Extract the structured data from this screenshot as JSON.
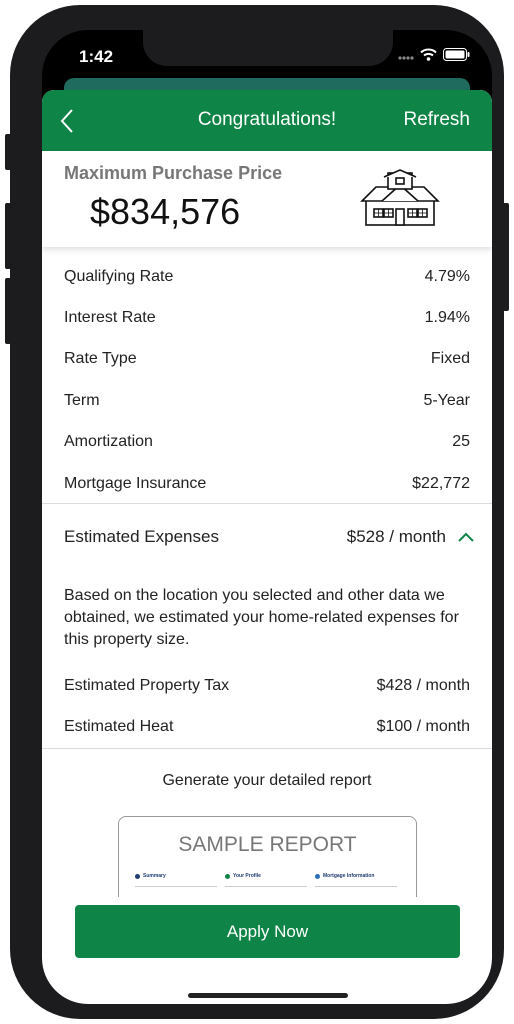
{
  "status_bar": {
    "time": "1:42"
  },
  "header": {
    "title": "Congratulations!",
    "refresh_label": "Refresh"
  },
  "price_card": {
    "label": "Maximum Purchase Price",
    "value": "$834,576"
  },
  "details": [
    {
      "label": "Qualifying Rate",
      "value": "4.79%"
    },
    {
      "label": "Interest Rate",
      "value": "1.94%"
    },
    {
      "label": "Rate Type",
      "value": "Fixed"
    },
    {
      "label": "Term",
      "value": "5-Year"
    },
    {
      "label": "Amortization",
      "value": "25"
    },
    {
      "label": "Mortgage Insurance",
      "value": "$22,772"
    }
  ],
  "expenses": {
    "label": "Estimated Expenses",
    "value": "$528 / month",
    "description": "Based on the location you selected and other data we obtained, we estimated your home-related expenses for this property size.",
    "items": [
      {
        "label": "Estimated Property Tax",
        "value": "$428 / month"
      },
      {
        "label": "Estimated Heat",
        "value": "$100 / month"
      }
    ]
  },
  "report": {
    "prompt": "Generate your detailed report",
    "sample_title": "SAMPLE REPORT",
    "sections": [
      "Summary",
      "Your Profile",
      "Mortgage Information"
    ]
  },
  "apply_label": "Apply Now",
  "colors": {
    "primary_green": "#0e8446",
    "text": "#222222",
    "muted": "#777777"
  }
}
